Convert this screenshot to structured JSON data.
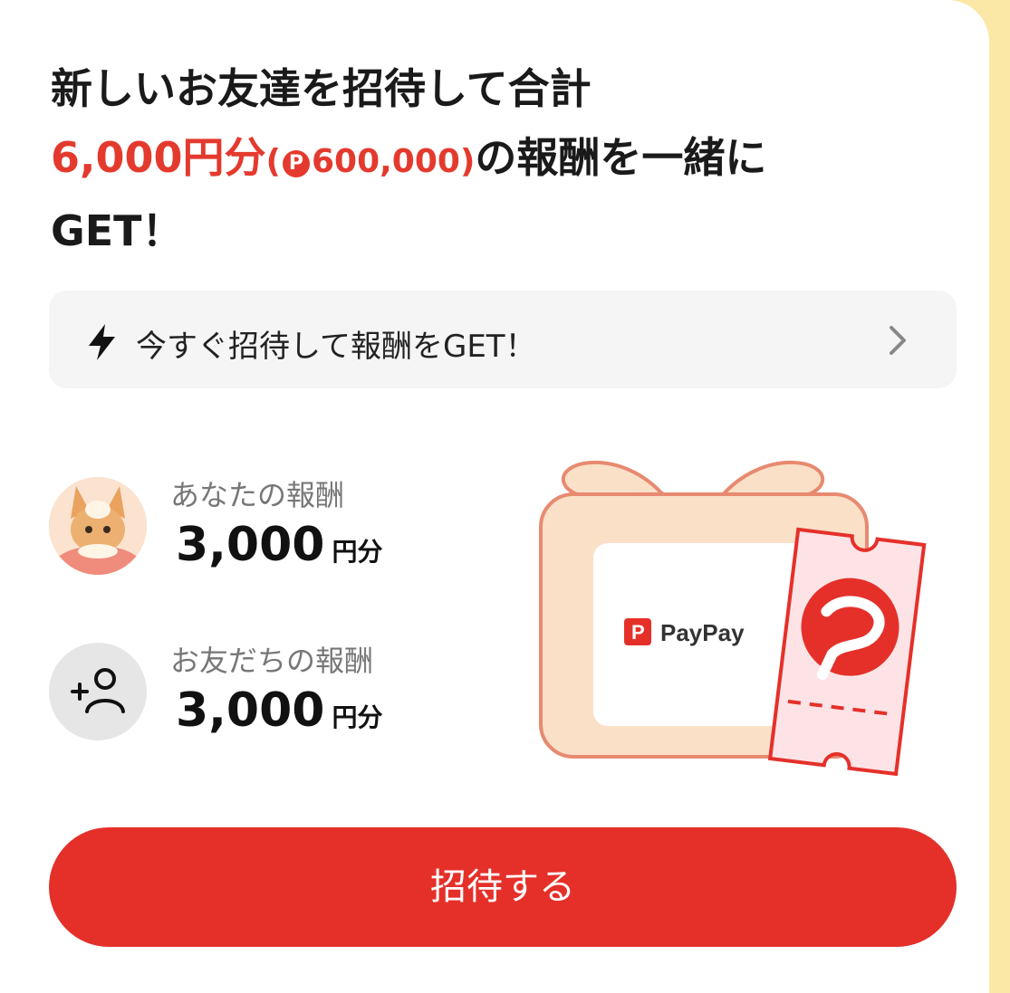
{
  "headline": {
    "line1": "新しいお友達を招待して合計",
    "amount": "6,000円分",
    "points_open": "(",
    "points_icon": "P",
    "points_value": "600,000)",
    "line2_rest": "の報酬を一緒に",
    "line3": "GET！"
  },
  "banner": {
    "icon": "lightning-icon",
    "text": "今すぐ招待して報酬をGET！",
    "chevron": "chevron-right-icon"
  },
  "rewards": [
    {
      "label": "あなたの報酬",
      "amount": "3,000",
      "unit": "円分",
      "icon": "avatar"
    },
    {
      "label": "お友だちの報酬",
      "amount": "3,000",
      "unit": "円分",
      "icon": "add-person-icon"
    }
  ],
  "gift_card": {
    "brand": "PayPay"
  },
  "cta": {
    "label": "招待する"
  },
  "colors": {
    "accent": "#e5302a",
    "headline_red": "#e43a2e",
    "background": "#fbe8a6"
  }
}
